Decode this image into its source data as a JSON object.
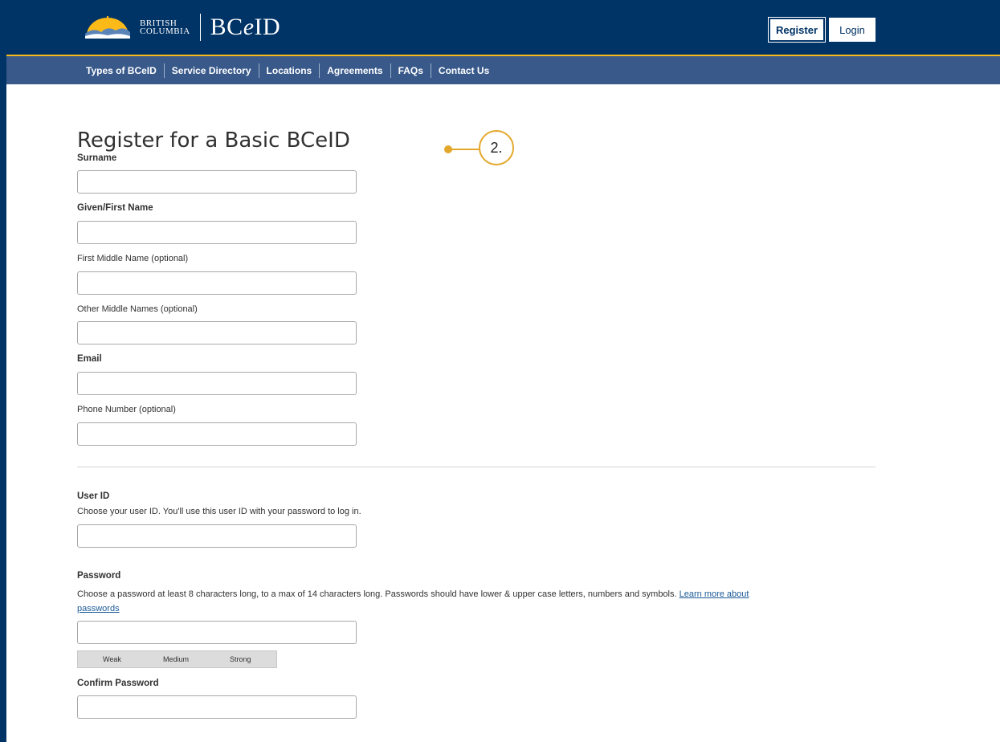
{
  "header": {
    "bc_line1": "BRITISH",
    "bc_line2": "COLUMBIA",
    "brand_prefix": "BC",
    "brand_e": "e",
    "brand_suffix": "ID",
    "register_label": "Register",
    "login_label": "Login",
    "colors": {
      "navy": "#003366",
      "gold": "#fcba19",
      "subnav": "#38598a"
    }
  },
  "subnav": {
    "items": [
      "Types of BCeID",
      "Service Directory",
      "Locations",
      "Agreements",
      "FAQs",
      "Contact Us"
    ]
  },
  "form": {
    "title": "Register for a Basic BCeID",
    "surname_label": "Surname",
    "given_label": "Given/First Name",
    "first_middle_label": "First Middle Name (optional)",
    "other_middle_label": "Other Middle Names (optional)",
    "email_label": "Email",
    "phone_label": "Phone Number (optional)",
    "userid_label": "User ID",
    "userid_help": "Choose your user ID. You'll use this user ID with your password to log in.",
    "password_label": "Password",
    "password_help": "Choose a password at least 8 characters long, to a max of 14 characters long. Passwords should have lower & upper case letters, numbers and symbols.",
    "password_link_1": "Learn more about",
    "password_link_2": "passwords",
    "strength_weak": "Weak",
    "strength_medium": "Medium",
    "strength_strong": "Strong",
    "confirm_label": "Confirm Password",
    "values": {
      "surname": "",
      "given": "",
      "first_middle": "",
      "other_middle": "",
      "email": "",
      "phone": "",
      "userid": "",
      "password": "",
      "confirm": ""
    }
  },
  "callout": {
    "label": "2.",
    "color": "#e3a82b"
  }
}
